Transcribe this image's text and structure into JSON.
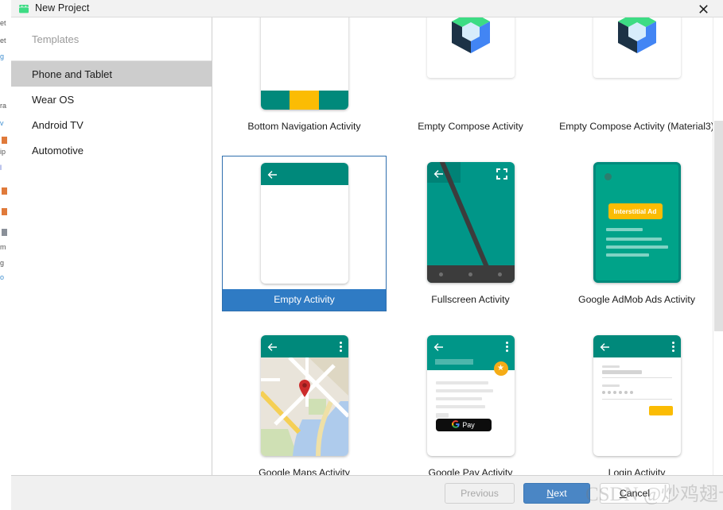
{
  "window": {
    "title": "New Project",
    "icon": "android-robot-icon",
    "close_label": "✕"
  },
  "sidebar": {
    "header": "Templates",
    "items": [
      {
        "label": "Phone and Tablet",
        "selected": true
      },
      {
        "label": "Wear OS",
        "selected": false
      },
      {
        "label": "Android TV",
        "selected": false
      },
      {
        "label": "Automotive",
        "selected": false
      }
    ]
  },
  "templates": {
    "rows": [
      [
        {
          "label": "Bottom Navigation Activity",
          "selected": false,
          "kind": "bottom-nav"
        },
        {
          "label": "Empty Compose Activity",
          "selected": false,
          "kind": "compose"
        },
        {
          "label": "Empty Compose Activity (Material3)",
          "selected": false,
          "kind": "compose"
        }
      ],
      [
        {
          "label": "Empty Activity",
          "selected": true,
          "kind": "empty"
        },
        {
          "label": "Fullscreen Activity",
          "selected": false,
          "kind": "fullscreen"
        },
        {
          "label": "Google AdMob Ads Activity",
          "selected": false,
          "kind": "admob"
        }
      ],
      [
        {
          "label": "Google Maps Activity",
          "selected": false,
          "kind": "maps"
        },
        {
          "label": "Google Pay Activity",
          "selected": false,
          "kind": "gpay"
        },
        {
          "label": "Login Activity",
          "selected": false,
          "kind": "login"
        }
      ]
    ],
    "admob_badge": "Interstitial Ad",
    "gpay_button": "Pay"
  },
  "footer": {
    "previous": "Previous",
    "next_prefix": "N",
    "next_rest": "ext",
    "cancel_prefix": "C",
    "cancel_rest": "ancel"
  },
  "watermark": {
    "site": "CSDN",
    "user": "@炒鸡翅卡"
  },
  "colors": {
    "accent_blue": "#2f7bc4",
    "teal": "#009688",
    "teal_dark": "#00897b",
    "amber": "#fbbc04",
    "selected_row": "#cdcdcd"
  }
}
